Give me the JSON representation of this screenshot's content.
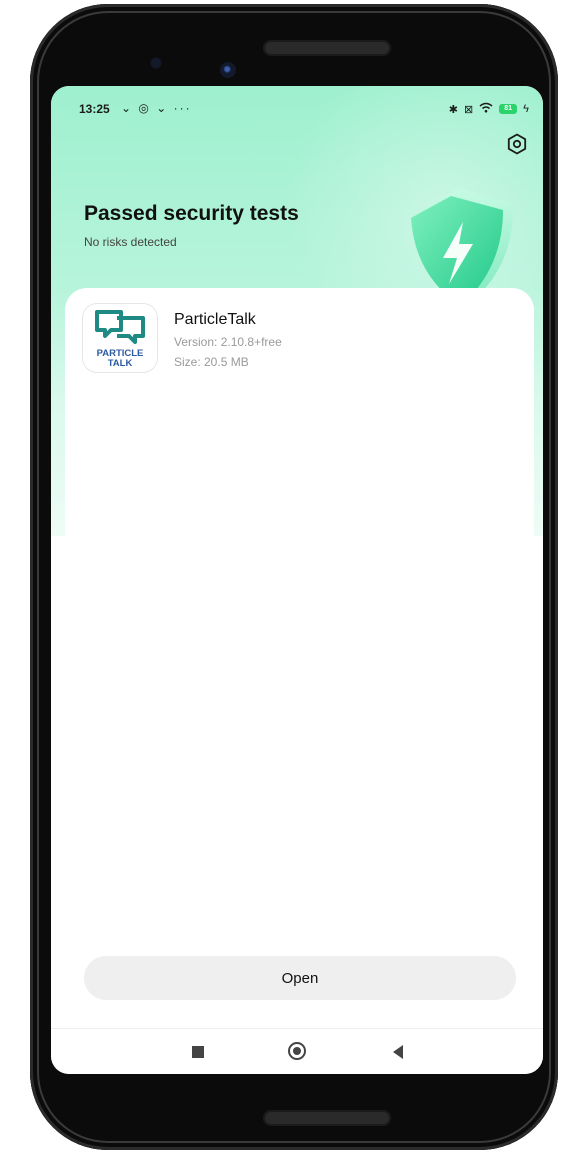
{
  "status_bar": {
    "time": "13:25",
    "left_icons": "⌄ ◎ ⌄ ···",
    "battery_level": "81",
    "icons": [
      "download-icon",
      "location-icon",
      "download-icon",
      "more-dots-icon",
      "bluetooth-icon",
      "sim-icon",
      "wifi-icon",
      "battery-icon",
      "charging-icon"
    ]
  },
  "header": {
    "title": "Passed security tests",
    "subtitle": "No risks detected"
  },
  "app": {
    "name": "ParticleTalk",
    "version": "Version: 2.10.8+free",
    "size": "Size: 20.5 MB",
    "icon_text_line1": "PARTICLE",
    "icon_text_line2": "TALK"
  },
  "actions": {
    "open_label": "Open"
  },
  "colors": {
    "accent_green": "#2bd36a",
    "hero_top": "#9ef0cf",
    "logo_teal": "#1f8a84",
    "logo_blue": "#2c5aa0"
  }
}
